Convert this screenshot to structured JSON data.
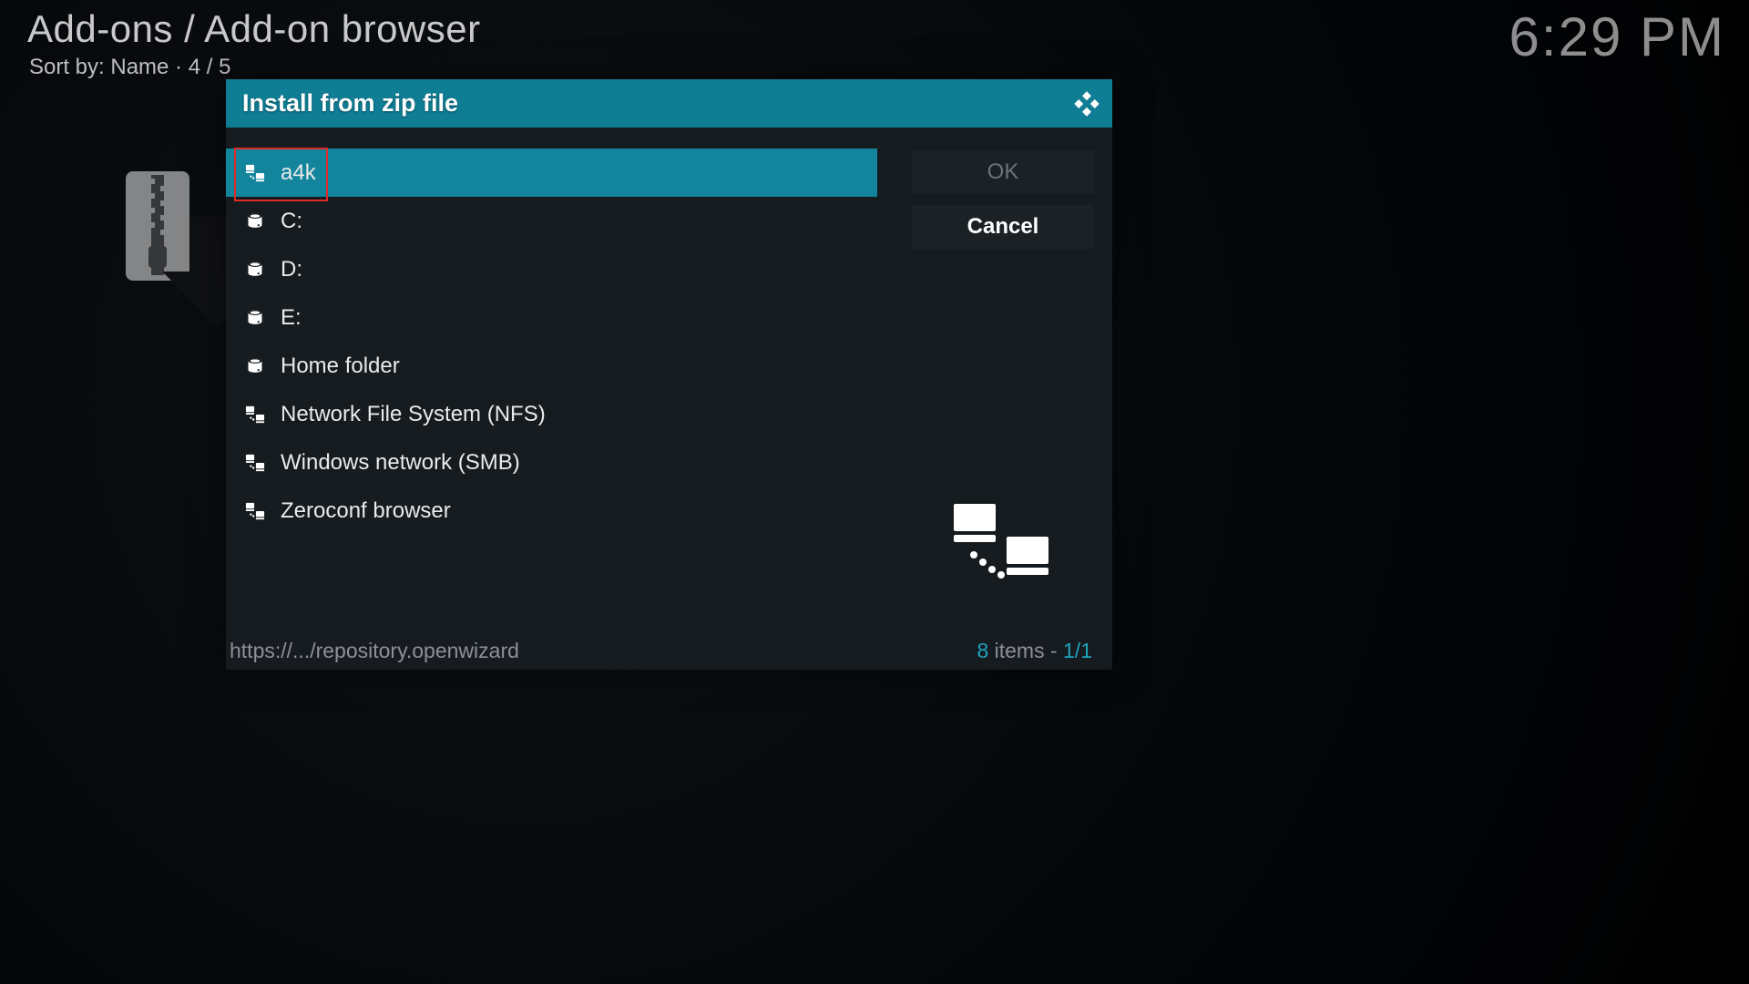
{
  "header": {
    "breadcrumb": "Add-ons / Add-on browser",
    "sort_line": "Sort by: Name  ·  4 / 5",
    "clock": "6:29 PM"
  },
  "dialog": {
    "title": "Install from zip file",
    "ok": "OK",
    "cancel": "Cancel",
    "footer_path": "https://.../repository.openwizard",
    "footer_count_num": "8",
    "footer_count_rest": " items - ",
    "footer_page": "1/1",
    "items": [
      {
        "label": "a4k",
        "icon": "network-icon",
        "selected": true
      },
      {
        "label": "C:",
        "icon": "drive-icon",
        "selected": false
      },
      {
        "label": "D:",
        "icon": "drive-icon",
        "selected": false
      },
      {
        "label": "E:",
        "icon": "drive-icon",
        "selected": false
      },
      {
        "label": "Home folder",
        "icon": "drive-icon",
        "selected": false
      },
      {
        "label": "Network File System (NFS)",
        "icon": "network-icon",
        "selected": false
      },
      {
        "label": "Windows network (SMB)",
        "icon": "network-icon",
        "selected": false
      },
      {
        "label": "Zeroconf browser",
        "icon": "network-icon",
        "selected": false
      }
    ]
  }
}
